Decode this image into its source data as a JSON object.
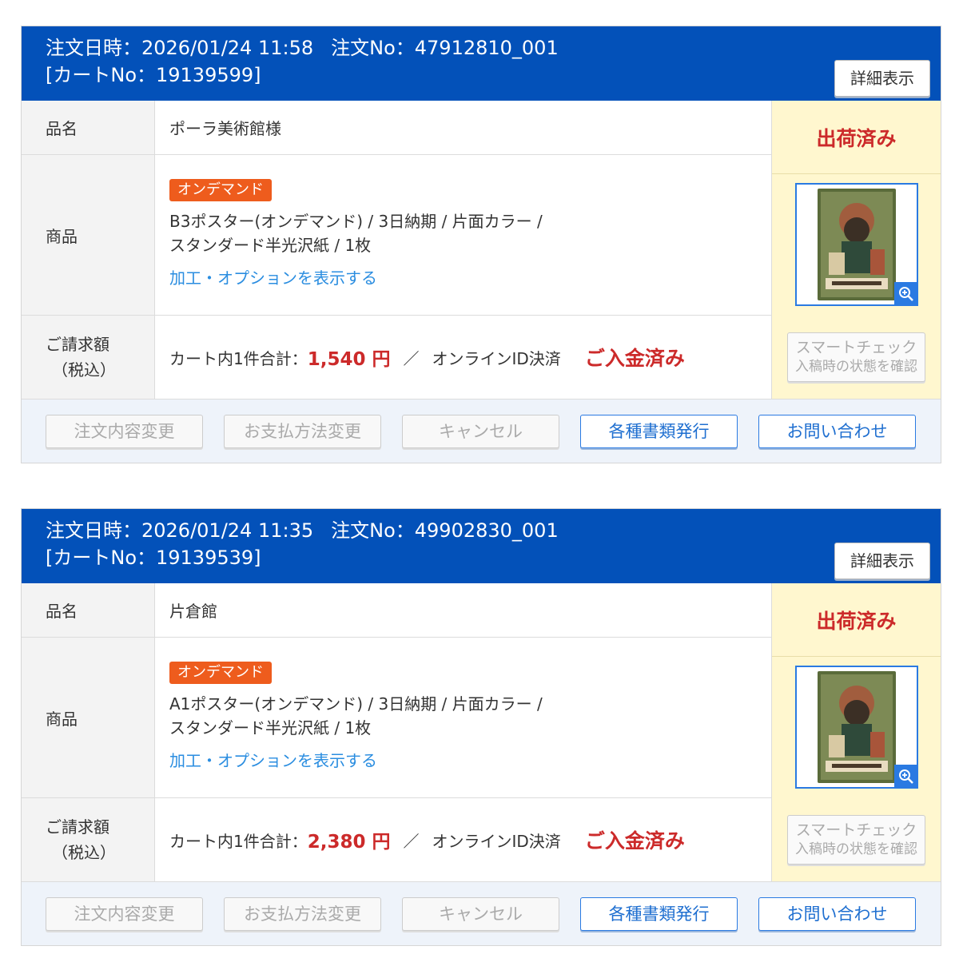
{
  "labels": {
    "detail": "詳細表示",
    "item_name": "品名",
    "product": "商品",
    "billing": "ご請求額",
    "billing_sub": "（税込）",
    "ondemand_badge": "オンデマンド",
    "show_options": "加工・オプションを表示する",
    "cart_total": "カート内1件合計：",
    "slash": "／",
    "payment_method": "オンラインID決済",
    "paid_status": "ご入金済み",
    "ship_status": "出荷済み",
    "smart_check_1": "スマートチェック",
    "smart_check_2": "入稿時の状態を確認",
    "btn_change_order": "注文内容変更",
    "btn_change_payment": "お支払方法変更",
    "btn_cancel": "キャンセル",
    "btn_documents": "各種書類発行",
    "btn_contact": "お問い合わせ"
  },
  "orders": [
    {
      "order_datetime": "注文日時：2026/01/24 11:58",
      "order_no": "注文No：47912810_001",
      "cart_no": "[カートNo：19139599]",
      "item_name": "ポーラ美術館様",
      "product_line1": "B3ポスター(オンデマンド) / 3日納期 / 片面カラー /",
      "product_line2": "スタンダード半光沢紙 / 1枚",
      "amount": "1,540 円"
    },
    {
      "order_datetime": "注文日時：2026/01/24 11:35",
      "order_no": "注文No：49902830_001",
      "cart_no": "[カートNo：19139539]",
      "item_name": "片倉館",
      "product_line1": "A1ポスター(オンデマンド) / 3日納期 / 片面カラー /",
      "product_line2": "スタンダード半光沢紙 / 1枚",
      "amount": "2,380 円"
    }
  ],
  "colors": {
    "header_blue": "#0351b9",
    "accent_red": "#cc2a2a",
    "badge_orange": "#ee5c1d",
    "link_blue": "#2a8de0",
    "status_bg": "#fff7cf"
  },
  "icons": {
    "zoom": "zoom-in-icon",
    "thumbnail": "poster-thumbnail"
  }
}
